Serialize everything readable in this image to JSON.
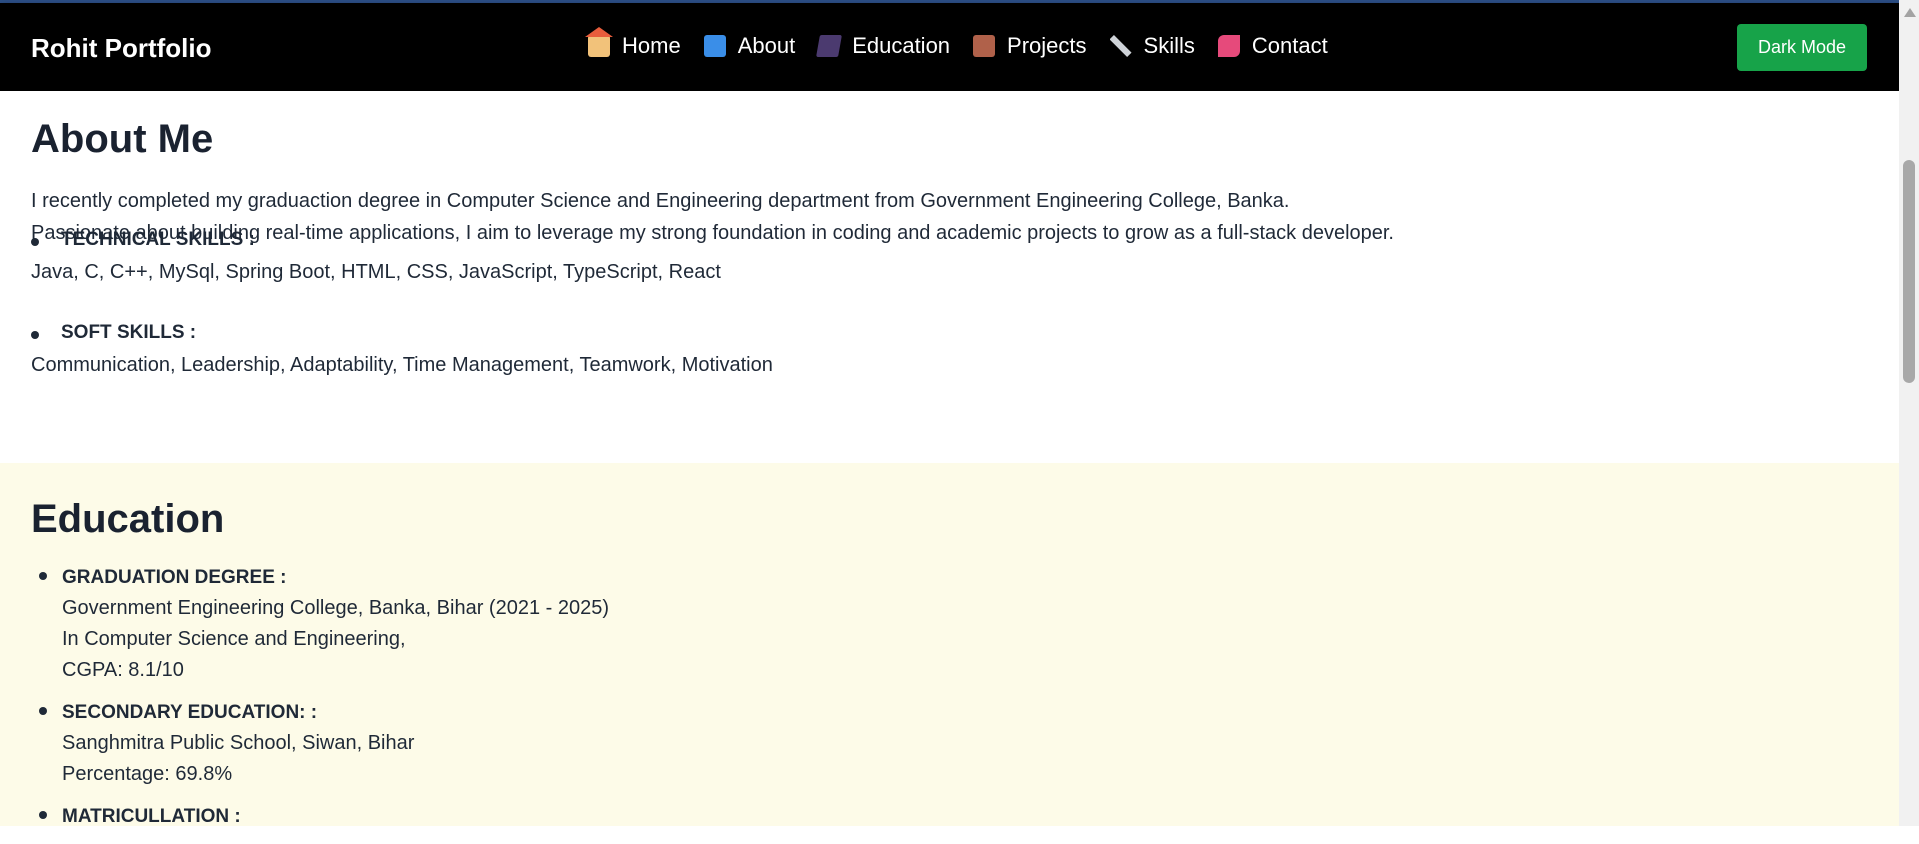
{
  "nav": {
    "brand": "Rohit Portfolio",
    "links": [
      {
        "label": "Home",
        "icon": "house-icon"
      },
      {
        "label": "About",
        "icon": "book-icon"
      },
      {
        "label": "Education",
        "icon": "graduation-cap-icon"
      },
      {
        "label": "Projects",
        "icon": "briefcase-icon"
      },
      {
        "label": "Skills",
        "icon": "tools-icon"
      },
      {
        "label": "Contact",
        "icon": "phone-icon"
      }
    ],
    "dark_mode_label": "Dark Mode",
    "accent_color": "#17a349"
  },
  "about": {
    "title": "About Me",
    "intro_1": "I recently completed my graduaction degree in Computer Science and Engineering department from Government Engineering College, Banka.",
    "intro_2": "Passionate about building real-time applications, I aim to leverage my strong foundation in coding and academic projects to grow as a full-stack developer.",
    "technical": {
      "heading": "TECHNICAL SKILLS :",
      "value": "Java, C, C++, MySql, Spring Boot, HTML, CSS, JavaScript, TypeScript, React"
    },
    "soft": {
      "heading": "SOFT SKILLS :",
      "value": "Communication, Leadership, Adaptability, Time Management, Teamwork, Motivation"
    }
  },
  "education": {
    "title": "Education",
    "items": [
      {
        "title": "GRADUATION DEGREE :",
        "lines": [
          "Government Engineering College, Banka, Bihar (2021 - 2025)",
          "In Computer Science and Engineering,",
          "CGPA: 8.1/10"
        ]
      },
      {
        "title": "SECONDARY EDUCATION: :",
        "lines": [
          "Sanghmitra Public School, Siwan, Bihar",
          "Percentage: 69.8%"
        ]
      },
      {
        "title": "MATRICULLATION :",
        "lines": []
      }
    ],
    "background_color": "#fdfbe8"
  }
}
